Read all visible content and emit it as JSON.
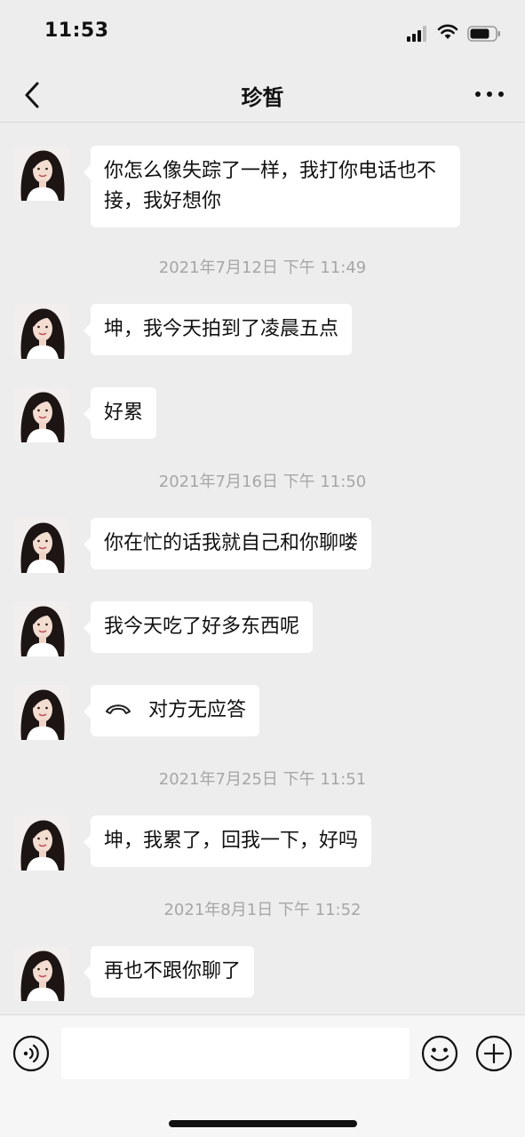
{
  "status_bar": {
    "time": "11:53",
    "signal_icon": "cellular-signal-icon",
    "wifi_icon": "wifi-icon",
    "battery_icon": "battery-icon"
  },
  "nav": {
    "title": "珍皙",
    "back_icon": "chevron-left-icon",
    "more_icon": "more-horizontal-icon"
  },
  "messages": [
    {
      "type": "text",
      "text": "你怎么像失踪了一样，我打你电话也不接，我好想你"
    },
    {
      "type": "timestamp",
      "text": "2021年7月12日 下午 11:49"
    },
    {
      "type": "text",
      "text": "坤，我今天拍到了凌晨五点"
    },
    {
      "type": "text",
      "text": "好累"
    },
    {
      "type": "timestamp",
      "text": "2021年7月16日 下午 11:50"
    },
    {
      "type": "text",
      "text": "你在忙的话我就自己和你聊喽"
    },
    {
      "type": "text",
      "text": "我今天吃了好多东西呢"
    },
    {
      "type": "call",
      "icon": "phone-hangup-icon",
      "text": "对方无应答"
    },
    {
      "type": "timestamp",
      "text": "2021年7月25日 下午 11:51"
    },
    {
      "type": "text",
      "text": "坤，我累了，回我一下，好吗"
    },
    {
      "type": "timestamp",
      "text": "2021年8月1日 下午 11:52"
    },
    {
      "type": "text",
      "text": "再也不跟你聊了"
    }
  ],
  "input_bar": {
    "placeholder": "",
    "voice_icon": "voice-icon",
    "emoji_icon": "emoji-icon",
    "plus_icon": "plus-circle-icon"
  },
  "colors": {
    "background": "#ededed",
    "bubble": "#ffffff",
    "timestamp_text": "#a6a6a6",
    "input_bar": "#f6f6f6"
  }
}
